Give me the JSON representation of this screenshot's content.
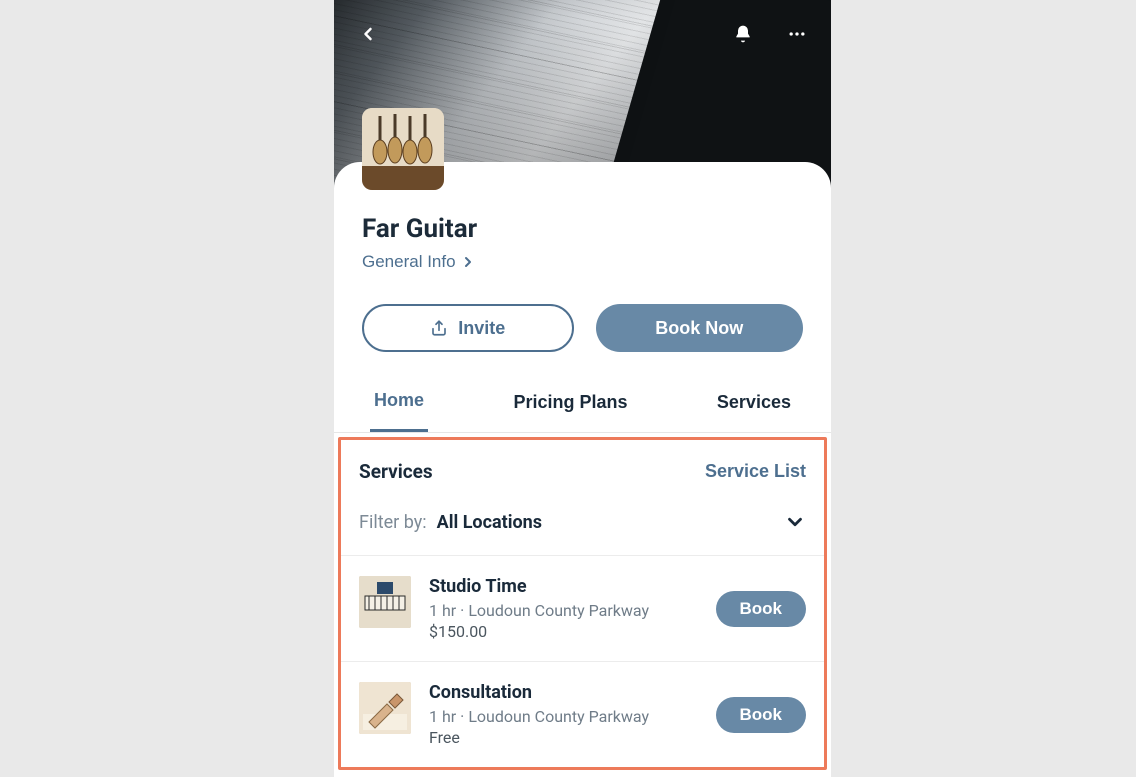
{
  "header": {
    "back_icon": "chevron-left",
    "bell_icon": "bell",
    "more_icon": "more-horizontal"
  },
  "profile": {
    "title": "Far Guitar",
    "general_info_label": "General Info",
    "invite_label": "Invite",
    "book_now_label": "Book Now"
  },
  "tabs": {
    "home": "Home",
    "pricing": "Pricing Plans",
    "services": "Services",
    "active": "home"
  },
  "services_section": {
    "heading": "Services",
    "service_list_label": "Service List",
    "filter_label": "Filter by:",
    "filter_value": "All Locations",
    "items": [
      {
        "name": "Studio Time",
        "meta": "1 hr · Loudoun County Parkway",
        "price": "$150.00",
        "book_label": "Book"
      },
      {
        "name": "Consultation",
        "meta": "1 hr · Loudoun County Parkway",
        "price": "Free",
        "book_label": "Book"
      }
    ]
  },
  "colors": {
    "accent": "#4d6f8f",
    "primary_button": "#6889a6",
    "highlight_border": "#ed7a5a"
  }
}
